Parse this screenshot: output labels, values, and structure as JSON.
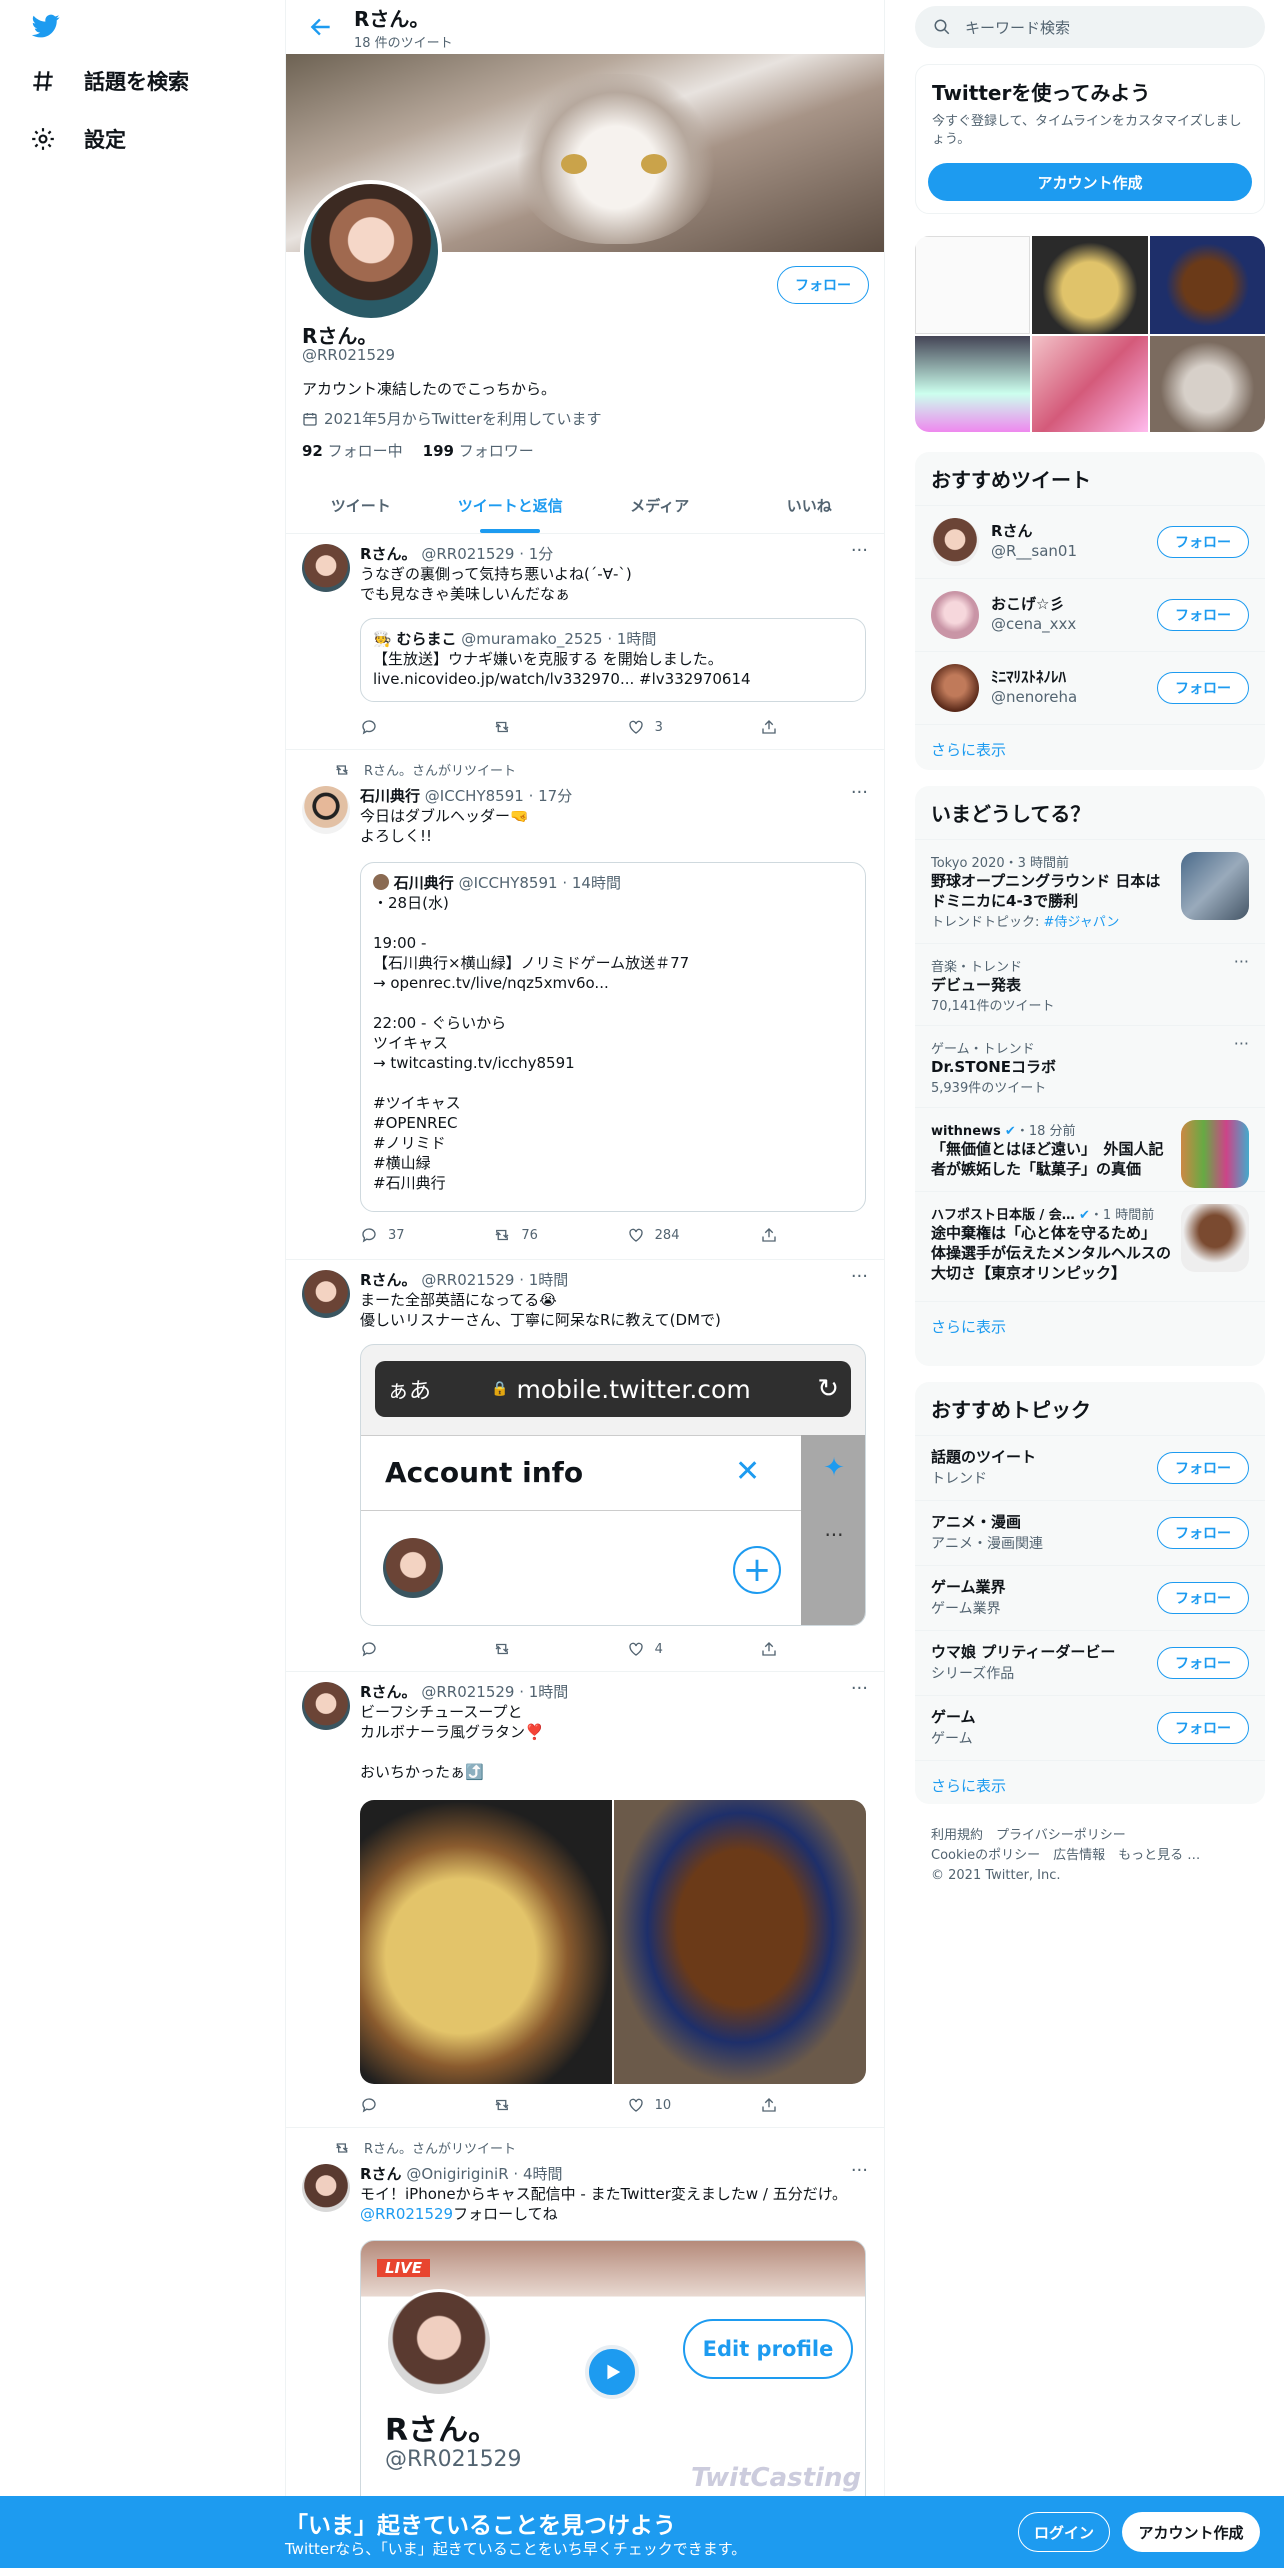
{
  "nav": {
    "explore_label": "話題を検索",
    "settings_label": "設定"
  },
  "header": {
    "title": "Rさん。",
    "tweet_count": "18 件のツイート"
  },
  "profile": {
    "name": "Rさん。",
    "handle": "@RR021529",
    "bio": "アカウント凍結したのでこっちから。",
    "joined": "2021年5月からTwitterを利用しています",
    "following_count": "92",
    "following_label": "フォロー中",
    "followers_count": "199",
    "followers_label": "フォロワー",
    "follow_button": "フォロー"
  },
  "tabs": [
    "ツイート",
    "ツイートと返信",
    "メディア",
    "いいね"
  ],
  "tweets": [
    {
      "name": "Rさん。",
      "handle": "@RR021529",
      "time": "1分",
      "text1": "うなぎの裏側って気持ち悪いよね(´-∀-`)",
      "text2": "でも見なきゃ美味しいんだなぁ",
      "quote_name": "むらまこ",
      "quote_handle": "@muramako_2525",
      "quote_time": "1時間",
      "quote_text1": "【生放送】ウナギ嫌いを克服する を開始しました。",
      "quote_text2": "live.nicovideo.jp/watch/lv332970... #lv332970614",
      "reply": "",
      "retweet": "",
      "like": "3"
    },
    {
      "rt_label": "Rさん。さんがリツイート",
      "name": "石川典行",
      "handle": "@ICCHY8591",
      "time": "17分",
      "text1": "今日はダブルヘッダー🤜",
      "text2": "よろしく!!",
      "quote_name": "石川典行",
      "quote_handle": "@ICCHY8591",
      "quote_time": "14時間",
      "quote_lines": [
        "・28日(水)",
        "",
        "19:00 -",
        "【石川典行×横山緑】ノリミドゲーム放送＃77",
        "→ openrec.tv/live/nqz5xmv6o...",
        "",
        "22:00 - ぐらいから",
        "ツイキャス",
        "→ twitcasting.tv/icchy8591",
        "",
        "#ツイキャス",
        "#OPENREC",
        "#ノリミド",
        "#横山緑",
        "#石川典行"
      ],
      "reply": "37",
      "retweet": "76",
      "like": "284"
    },
    {
      "name": "Rさん。",
      "handle": "@RR021529",
      "time": "1時間",
      "text1": "まーた全部英語になってる😭",
      "text2": "優しいリスナーさん、丁寧に阿呆なRに教えて(DMで)",
      "shot_aa": "ぁあ",
      "shot_url": "mobile.twitter.com",
      "shot_title": "Account info",
      "reply": "",
      "retweet": "",
      "like": "4"
    },
    {
      "name": "Rさん。",
      "handle": "@RR021529",
      "time": "1時間",
      "text1": "ビーフシチュースープと",
      "text2": "カルボナーラ風グラタン❣️",
      "text3": "おいちかったぁ⤴️",
      "reply": "",
      "retweet": "",
      "like": "10"
    },
    {
      "rt_label": "Rさん。さんがリツイート",
      "name": "Rさん",
      "handle": "@OnigiriginiR",
      "time": "4時間",
      "text1": "モイ！iPhoneからキャス配信中 - またTwitter変えましたw / 五分だけ。",
      "mention": "@RR021529",
      "text2": "フォローしてね",
      "card_live": "LIVE",
      "card_edit": "Edit profile",
      "card_name": "Rさん。",
      "card_handle": "@RR021529",
      "card_brand": "TwitCasting"
    }
  ],
  "right": {
    "search_placeholder": "キーワード検索",
    "signup_title": "Twitterを使ってみよう",
    "signup_text": "今すぐ登録して、タイムラインをカスタマイズしましょう。",
    "signup_button": "アカウント作成",
    "rec_title": "おすすめツイート",
    "rec_users": [
      {
        "name": "Rさん",
        "handle": "@R__san01"
      },
      {
        "name": "おこげ☆彡",
        "handle": "@cena_xxx"
      },
      {
        "name": "ﾐﾆﾏﾘｽﾄﾈﾉﾚﾊ",
        "handle": "@nenoreha"
      }
    ],
    "show_more": "さらに表示",
    "trends_title": "いまどうしてる？",
    "trends": [
      {
        "meta": "Tokyo 2020・3 時間前",
        "title": "野球オープニングラウンド 日本はドミニカに4-3で勝利",
        "sub_label": "トレンドトピック: ",
        "sub_link": "#侍ジャパン"
      },
      {
        "meta": "音楽・トレンド",
        "title": "デビュー発表",
        "sub": "70,141件のツイート"
      },
      {
        "meta": "ゲーム・トレンド",
        "title": "Dr.STONEコラボ",
        "sub": "5,939件のツイート"
      },
      {
        "meta_name": "withnews",
        "meta_time": "・18 分前",
        "title": "「無価値とはほど遠い」　外国人記者が嫉妬した「駄菓子」の真価"
      },
      {
        "meta_name": "ハフポスト日本版 / 会…",
        "meta_time": "・1 時間前",
        "title": "途中棄権は「心と体を守るため」　体操選手が伝えたメンタルヘルスの大切さ【東京オリンピック】"
      }
    ],
    "topics_title": "おすすめトピック",
    "topics": [
      {
        "name": "話題のツイート",
        "sub": "トレンド"
      },
      {
        "name": "アニメ・漫画",
        "sub": "アニメ・漫画関連"
      },
      {
        "name": "ゲーム業界",
        "sub": "ゲーム業界"
      },
      {
        "name": "ウマ娘 プリティーダービー",
        "sub": "シリーズ作品"
      },
      {
        "name": "ゲーム",
        "sub": "ゲーム"
      }
    ],
    "footer1": [
      "利用規約",
      "プライバシーポリシー"
    ],
    "footer2": [
      "Cookieのポリシー",
      "広告情報",
      "もっと見る …"
    ],
    "copyright": "© 2021 Twitter, Inc."
  },
  "bottom": {
    "headline": "「いま」起きていることを見つけよう",
    "sub": "Twitterなら、「いま」起きていることをいち早くチェックできます。",
    "login": "ログイン",
    "signup": "アカウント作成"
  },
  "colors": {
    "accent": "#1d9bf0",
    "text": "#0f1419",
    "muted": "#536471"
  }
}
